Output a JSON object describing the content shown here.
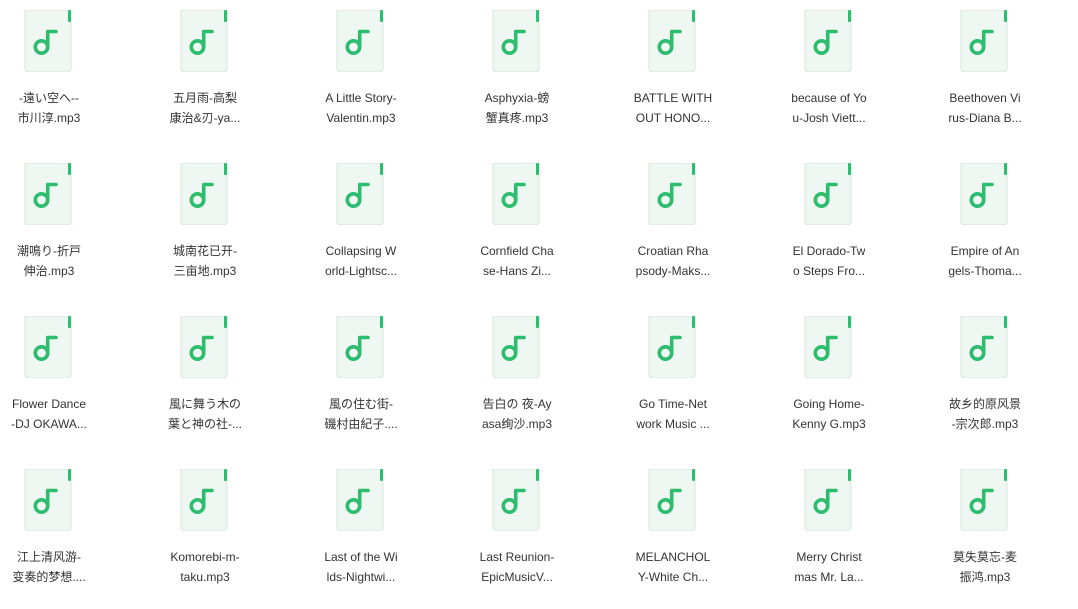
{
  "files": [
    {
      "name": "-遠い空へ--\n市川淳.mp3"
    },
    {
      "name": "五月雨-高梨\n康治&刃-ya..."
    },
    {
      "name": "A Little Story-\nValentin.mp3"
    },
    {
      "name": "Asphyxia-螃\n蟹真疼.mp3"
    },
    {
      "name": "BATTLE WITH\nOUT HONO..."
    },
    {
      "name": "because of Yo\nu-Josh Viett..."
    },
    {
      "name": "Beethoven Vi\nrus-Diana B..."
    },
    {
      "name": "潮鳴り-折戸\n伸治.mp3"
    },
    {
      "name": "城南花已开-\n三亩地.mp3"
    },
    {
      "name": "Collapsing W\norld-Lightsc..."
    },
    {
      "name": "Cornfield Cha\nse-Hans Zi..."
    },
    {
      "name": "Croatian Rha\npsody-Maks..."
    },
    {
      "name": "El Dorado-Tw\no Steps Fro..."
    },
    {
      "name": "Empire of An\ngels-Thoma..."
    },
    {
      "name": "Flower Dance\n-DJ OKAWA..."
    },
    {
      "name": "風に舞う木の\n葉と神の社-..."
    },
    {
      "name": "風の住む街-\n磯村由紀子...."
    },
    {
      "name": "告白の 夜-Ay\nasa绚沙.mp3"
    },
    {
      "name": "Go Time-Net\nwork Music ..."
    },
    {
      "name": "Going Home-\nKenny G.mp3"
    },
    {
      "name": "故乡的原风景\n-宗次郎.mp3"
    },
    {
      "name": "江上清风游-\n变奏的梦想...."
    },
    {
      "name": "Komorebi-m-\ntaku.mp3"
    },
    {
      "name": "Last of the Wi\nlds-Nightwi..."
    },
    {
      "name": "Last Reunion-\nEpicMusicV..."
    },
    {
      "name": "MELANCHOL\nY-White Ch..."
    },
    {
      "name": "Merry Christ\nmas Mr. La..."
    },
    {
      "name": "莫失莫忘-麦\n振鸿.mp3"
    }
  ],
  "icon": "music-file-icon",
  "colors": {
    "icon_fill": "#eef7f1",
    "icon_border": "#d3e6da",
    "accent": "#2dbd6e",
    "text": "#333333"
  }
}
